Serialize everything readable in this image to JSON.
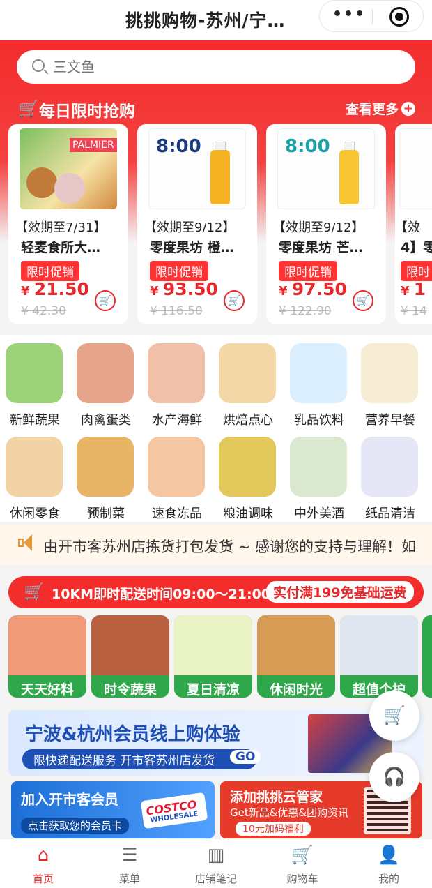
{
  "app": {
    "title": "挑挑购物-苏州/宁…",
    "menu_dots": "•••"
  },
  "search": {
    "placeholder": "三文鱼"
  },
  "flash_sale": {
    "title": "每日限时抢购",
    "more": "查看更多",
    "items": [
      {
        "line1": "【效期至7/31】",
        "line2": "轻麦食所大…",
        "badge": "限时促销",
        "price": "21.50",
        "old_price": "¥ 42.30"
      },
      {
        "line1": "【效期至9/12】",
        "line2": "零度果坊 橙…",
        "badge": "限时促销",
        "price": "93.50",
        "old_price": "¥ 116.50"
      },
      {
        "line1": "【效期至9/12】",
        "line2": "零度果坊 芒…",
        "badge": "限时促销",
        "price": "97.50",
        "old_price": "¥ 122.90"
      },
      {
        "line1": "【效",
        "line2": "4】零",
        "badge": "限时",
        "price": "1",
        "old_price": "¥ 14"
      }
    ],
    "product_labels": [
      "PALMIER",
      "8:00",
      "8:00"
    ]
  },
  "categories": [
    {
      "label": "新鲜蔬果",
      "color": "#9cd27a"
    },
    {
      "label": "肉禽蛋类",
      "color": "#e6a48a"
    },
    {
      "label": "水产海鲜",
      "color": "#f0c0a8"
    },
    {
      "label": "烘焙点心",
      "color": "#f3d7a6"
    },
    {
      "label": "乳品饮料",
      "color": "#dbeefd"
    },
    {
      "label": "营养早餐",
      "color": "#f6ecd3"
    },
    {
      "label": "休闲零食",
      "color": "#f2d3a5"
    },
    {
      "label": "预制菜",
      "color": "#e7b565"
    },
    {
      "label": "速食冻品",
      "color": "#f5c6a2"
    },
    {
      "label": "粮油调味",
      "color": "#e2c85a"
    },
    {
      "label": "中外美酒",
      "color": "#d9e8cf"
    },
    {
      "label": "纸品清洁",
      "color": "#e5e7f6"
    }
  ],
  "notice": {
    "text": "由开市客苏州店拣货打包发货 ~ 感谢您的支持与理解！如"
  },
  "delivery": {
    "text": "10KM即时配送时间09:00～21:00",
    "promo": "实付满199免基础运费"
  },
  "themes": [
    {
      "label": "天天好料",
      "color": "#f19a7a"
    },
    {
      "label": "时令蔬果",
      "color": "#b8603f"
    },
    {
      "label": "夏日清凉",
      "color": "#e9f3c6"
    },
    {
      "label": "休闲时光",
      "color": "#d79b55"
    },
    {
      "label": "超值个护",
      "color": "#dfe6ef"
    }
  ],
  "banners": {
    "member": {
      "title": "宁波&杭州会员线上购体验",
      "subtitle": "限快递配送服务 开市客苏州店发货",
      "go": "GO"
    },
    "join": {
      "title": "加入开市客会员",
      "button": "点击获取您的会员卡",
      "logo_text": "COSTCO",
      "logo_sub": "WHOLESALE"
    },
    "steward": {
      "title": "添加挑挑云管家",
      "subtitle": "Get新品&优惠&团购资讯",
      "button": "10元加码福利"
    }
  },
  "tabbar": [
    {
      "label": "首页",
      "active": true
    },
    {
      "label": "菜单",
      "active": false
    },
    {
      "label": "店铺笔记",
      "active": false
    },
    {
      "label": "购物车",
      "active": false
    },
    {
      "label": "我的",
      "active": false
    }
  ],
  "colors": {
    "brand_red": "#e8282b",
    "hero_red": "#f32c2c",
    "theme_green": "#2fa84b"
  }
}
